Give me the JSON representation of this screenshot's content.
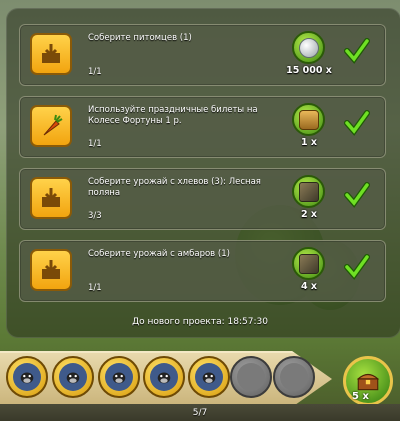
{
  "tasks": [
    {
      "title": "Соберите питомцев (1)",
      "progress": "1/1",
      "reward_count": "15 000 x",
      "icon": "deposit-box-icon",
      "reward_icon": "silver-coin-icon"
    },
    {
      "title": "Используйте праздничные билеты на Колесе Фортуны 1 р.",
      "progress": "1/1",
      "reward_count": "1 x",
      "icon": "carrot-icon",
      "reward_icon": "bag-icon"
    },
    {
      "title": "Соберите урожай с хлевов (3): Лесная поляна",
      "progress": "3/3",
      "reward_count": "2 x",
      "icon": "deposit-box-icon",
      "reward_icon": "seed-pack-icon"
    },
    {
      "title": "Соберите урожай с амбаров (1)",
      "progress": "1/1",
      "reward_count": "4 x",
      "icon": "deposit-box-icon",
      "reward_icon": "seed-pack-icon"
    }
  ],
  "timer_text": "До нового проекта: 18:57:30",
  "stages": {
    "completed": 5,
    "total": 7,
    "label": "5/7"
  },
  "final_reward": {
    "count": "5 x",
    "icon": "treasure-chest-icon"
  },
  "colors": {
    "accent_gold": "#f2a40f",
    "reward_green": "#3f8a12",
    "check_green": "#5fd11b"
  }
}
